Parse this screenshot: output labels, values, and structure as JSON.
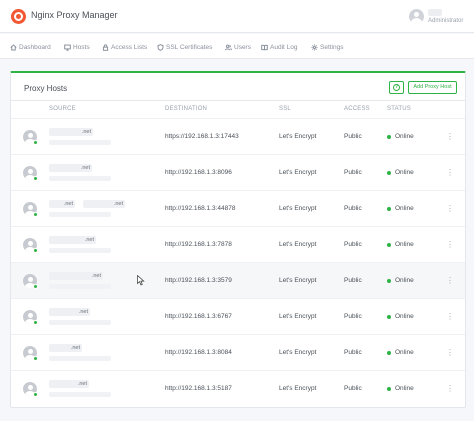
{
  "header": {
    "app_title": "Nginx Proxy Manager",
    "user_role": "Administrator"
  },
  "nav": {
    "items": [
      {
        "label": "Dashboard",
        "icon": "home-icon"
      },
      {
        "label": "Hosts",
        "icon": "monitor-icon"
      },
      {
        "label": "Access Lists",
        "icon": "lock-icon"
      },
      {
        "label": "SSL Certificates",
        "icon": "shield-icon"
      },
      {
        "label": "Users",
        "icon": "users-icon"
      },
      {
        "label": "Audit Log",
        "icon": "book-icon"
      },
      {
        "label": "Settings",
        "icon": "gear-icon"
      }
    ]
  },
  "card": {
    "title": "Proxy Hosts",
    "help_icon": "?",
    "add_button": "Add Proxy Host"
  },
  "table": {
    "columns": [
      "SOURCE",
      "DESTINATION",
      "SSL",
      "ACCESS",
      "STATUS"
    ],
    "rows": [
      {
        "source_suffix": ".net",
        "destination": "https://192.168.1.3:17443",
        "ssl": "Let's Encrypt",
        "access": "Public",
        "status": "Online"
      },
      {
        "source_suffix": ".net",
        "destination": "http://192.168.1.3:8096",
        "ssl": "Let's Encrypt",
        "access": "Public",
        "status": "Online"
      },
      {
        "source_suffix": ".net",
        "source_suffix_2": ".net",
        "destination": "http://192.168.1.3:44878",
        "ssl": "Let's Encrypt",
        "access": "Public",
        "status": "Online"
      },
      {
        "source_suffix": ".net",
        "destination": "http://192.168.1.3:7878",
        "ssl": "Let's Encrypt",
        "access": "Public",
        "status": "Online"
      },
      {
        "source_suffix": ".net",
        "destination": "http://192.168.1.3:3579",
        "ssl": "Let's Encrypt",
        "access": "Public",
        "status": "Online"
      },
      {
        "source_suffix": ".net",
        "destination": "http://192.168.1.3:6767",
        "ssl": "Let's Encrypt",
        "access": "Public",
        "status": "Online"
      },
      {
        "source_suffix": ".net",
        "destination": "http://192.168.1.3:8084",
        "ssl": "Let's Encrypt",
        "access": "Public",
        "status": "Online"
      },
      {
        "source_suffix": ".net",
        "destination": "http://192.168.1.3:5187",
        "ssl": "Let's Encrypt",
        "access": "Public",
        "status": "Online"
      }
    ]
  },
  "colors": {
    "accent": "#2fb344",
    "brand": "#f15833"
  }
}
